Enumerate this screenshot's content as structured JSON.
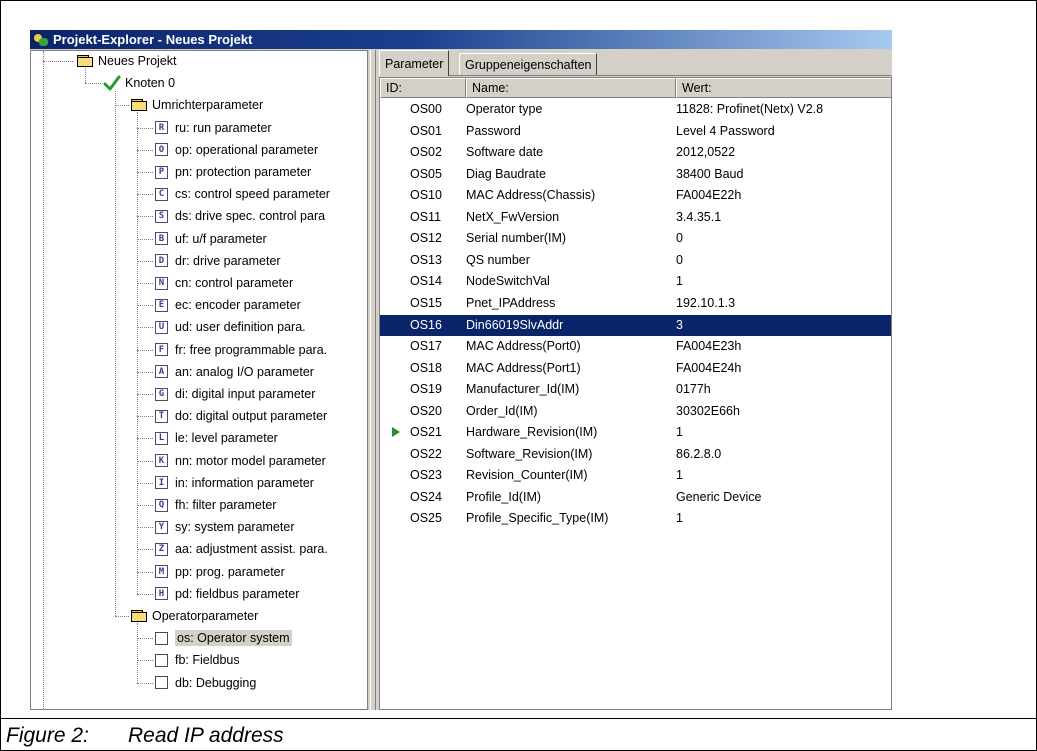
{
  "window": {
    "title": "Projekt-Explorer - Neues Projekt"
  },
  "tree": {
    "root": "Neues Projekt",
    "node": "Knoten 0",
    "groups": [
      {
        "label": "Umrichterparameter",
        "items": [
          {
            "letter": "R",
            "label": "ru: run parameter"
          },
          {
            "letter": "O",
            "label": "op: operational parameter"
          },
          {
            "letter": "P",
            "label": "pn: protection parameter"
          },
          {
            "letter": "C",
            "label": "cs: control speed parameter"
          },
          {
            "letter": "S",
            "label": "ds: drive spec. control para"
          },
          {
            "letter": "B",
            "label": "uf: u/f parameter"
          },
          {
            "letter": "D",
            "label": "dr: drive parameter"
          },
          {
            "letter": "N",
            "label": "cn: control parameter"
          },
          {
            "letter": "E",
            "label": "ec: encoder parameter"
          },
          {
            "letter": "U",
            "label": "ud: user definition para."
          },
          {
            "letter": "F",
            "label": "fr: free programmable para."
          },
          {
            "letter": "A",
            "label": "an: analog I/O parameter"
          },
          {
            "letter": "G",
            "label": "di: digital input parameter"
          },
          {
            "letter": "T",
            "label": "do: digital output parameter"
          },
          {
            "letter": "L",
            "label": "le: level parameter"
          },
          {
            "letter": "K",
            "label": "nn: motor model parameter"
          },
          {
            "letter": "I",
            "label": "in: information parameter"
          },
          {
            "letter": "Q",
            "label": "fh: filter parameter"
          },
          {
            "letter": "Y",
            "label": "sy: system parameter"
          },
          {
            "letter": "Z",
            "label": "aa: adjustment assist. para."
          },
          {
            "letter": "M",
            "label": "pp: prog. parameter"
          },
          {
            "letter": "H",
            "label": "pd: fieldbus parameter"
          }
        ]
      },
      {
        "label": "Operatorparameter",
        "items": [
          {
            "label": "os: Operator system"
          },
          {
            "label": "fb: Fieldbus"
          },
          {
            "label": "db: Debugging"
          }
        ]
      }
    ]
  },
  "tabs": [
    "Parameter",
    "Gruppeneigenschaften"
  ],
  "list": {
    "headers": [
      "ID:",
      "Name:",
      "Wert:"
    ],
    "selected_row": 10,
    "marker_row": 15,
    "rows": [
      {
        "id": "OS00",
        "name": "Operator type",
        "value": "11828: Profinet(Netx) V2.8"
      },
      {
        "id": "OS01",
        "name": "Password",
        "value": "Level 4 Password"
      },
      {
        "id": "OS02",
        "name": "Software date",
        "value": "2012,0522"
      },
      {
        "id": "OS05",
        "name": "Diag Baudrate",
        "value": "38400 Baud"
      },
      {
        "id": "OS10",
        "name": "MAC Address(Chassis)",
        "value": "FA004E22h"
      },
      {
        "id": "OS11",
        "name": "NetX_FwVersion",
        "value": "3.4.35.1"
      },
      {
        "id": "OS12",
        "name": "Serial number(IM)",
        "value": "0"
      },
      {
        "id": "OS13",
        "name": "QS number",
        "value": "0"
      },
      {
        "id": "OS14",
        "name": "NodeSwitchVal",
        "value": "1"
      },
      {
        "id": "OS15",
        "name": "Pnet_IPAddress",
        "value": "192.10.1.3"
      },
      {
        "id": "OS16",
        "name": "Din66019SlvAddr",
        "value": "3"
      },
      {
        "id": "OS17",
        "name": "MAC Address(Port0)",
        "value": "FA004E23h"
      },
      {
        "id": "OS18",
        "name": "MAC Address(Port1)",
        "value": "FA004E24h"
      },
      {
        "id": "OS19",
        "name": "Manufacturer_Id(IM)",
        "value": "0177h"
      },
      {
        "id": "OS20",
        "name": "Order_Id(IM)",
        "value": "30302E66h"
      },
      {
        "id": "OS21",
        "name": "Hardware_Revision(IM)",
        "value": "1"
      },
      {
        "id": "OS22",
        "name": "Software_Revision(IM)",
        "value": "86.2.8.0"
      },
      {
        "id": "OS23",
        "name": "Revision_Counter(IM)",
        "value": "1"
      },
      {
        "id": "OS24",
        "name": "Profile_Id(IM)",
        "value": "Generic Device"
      },
      {
        "id": "OS25",
        "name": "Profile_Specific_Type(IM)",
        "value": "1"
      }
    ]
  },
  "caption": {
    "number": "Figure 2:",
    "text": "Read IP address"
  }
}
